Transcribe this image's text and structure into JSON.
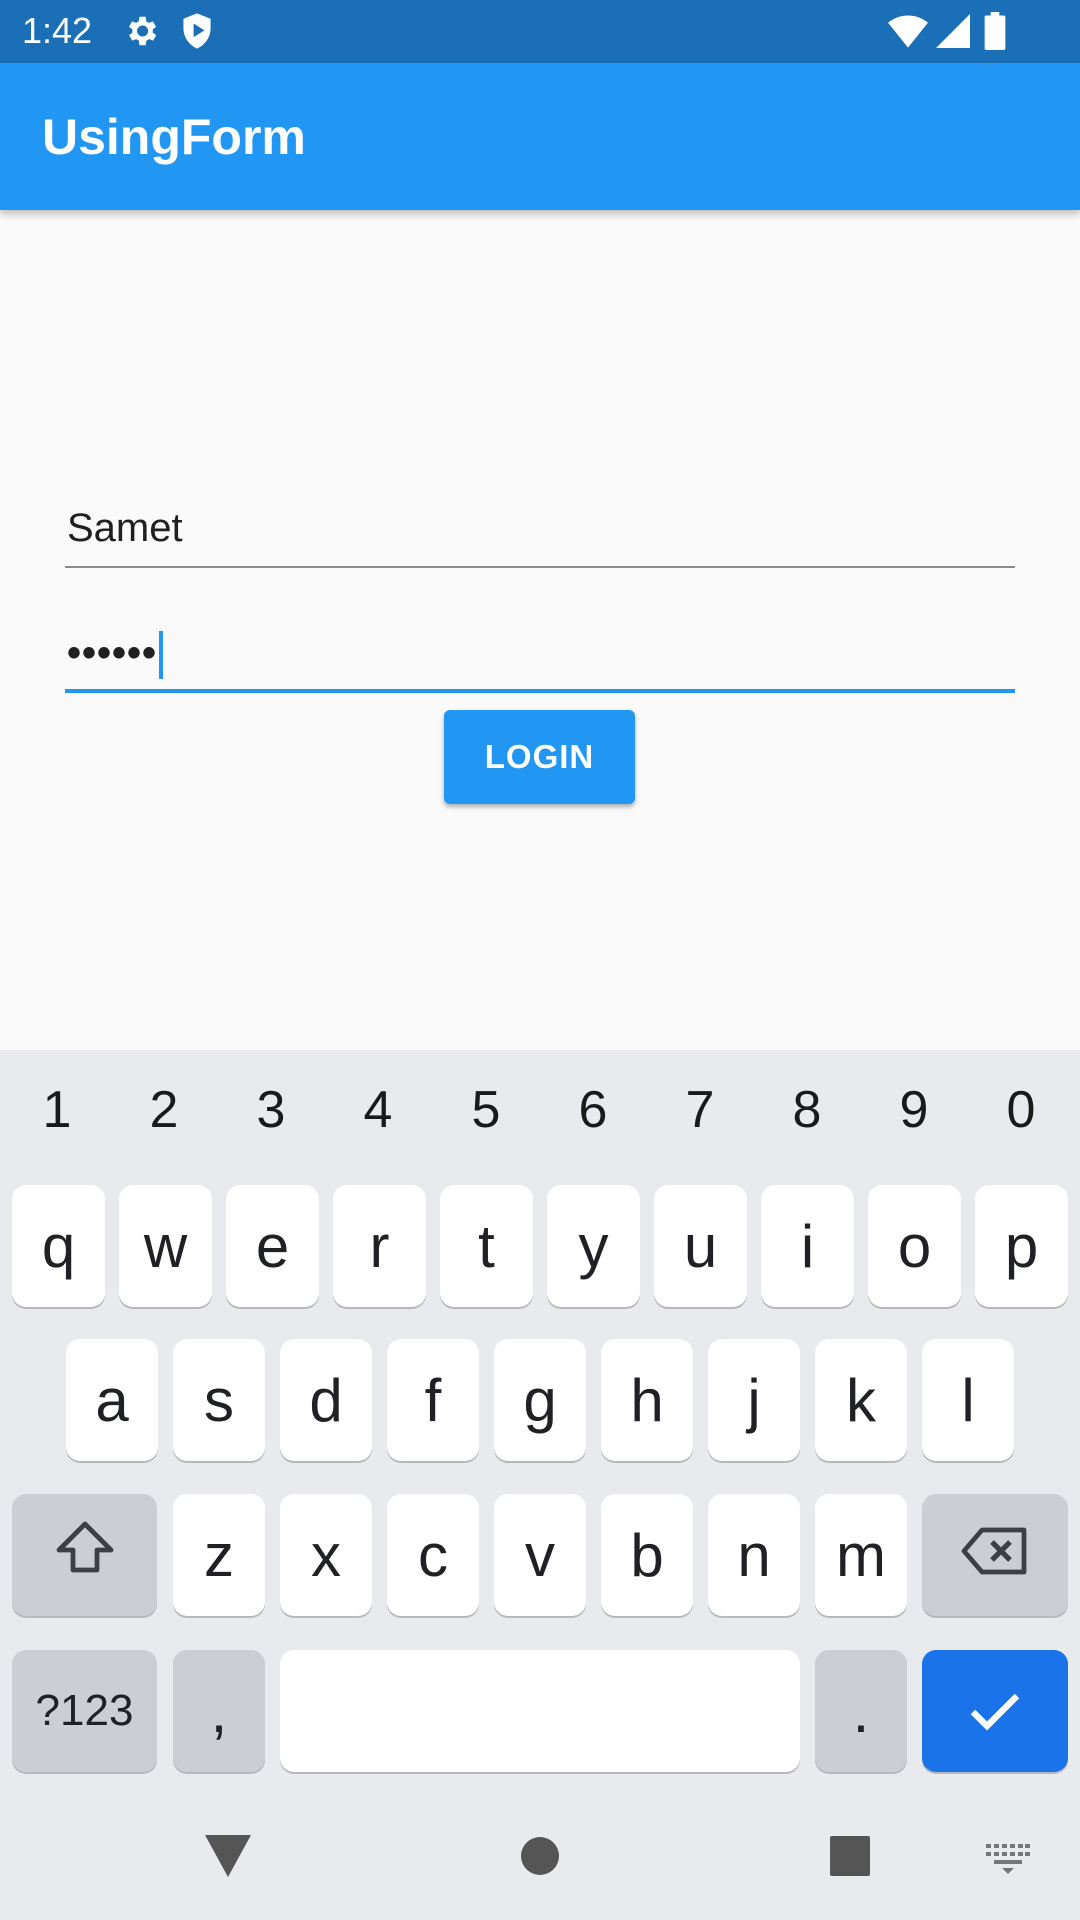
{
  "status_bar": {
    "time": "1:42",
    "icons": [
      "gear-icon",
      "shield-icon",
      "wifi-icon",
      "signal-icon",
      "battery-icon"
    ]
  },
  "app_bar": {
    "title": "UsingForm"
  },
  "form": {
    "username_value": "Samet",
    "password_value": "••••••",
    "login_label": "LOGIN"
  },
  "keyboard": {
    "number_row": [
      "1",
      "2",
      "3",
      "4",
      "5",
      "6",
      "7",
      "8",
      "9",
      "0"
    ],
    "row1": [
      "q",
      "w",
      "e",
      "r",
      "t",
      "y",
      "u",
      "i",
      "o",
      "p"
    ],
    "row2": [
      "a",
      "s",
      "d",
      "f",
      "g",
      "h",
      "j",
      "k",
      "l"
    ],
    "row3": [
      "z",
      "x",
      "c",
      "v",
      "b",
      "n",
      "m"
    ],
    "symbols_label": "?123",
    "comma_label": ",",
    "period_label": ".",
    "icons": [
      "shift-icon",
      "backspace-icon",
      "checkmark-icon"
    ]
  },
  "nav_bar": {
    "icons": [
      "back-icon",
      "home-icon",
      "recents-icon",
      "keyboard-switch-icon"
    ]
  },
  "colors": {
    "status_bar": "#1a6fb6",
    "app_bar": "#2196f3",
    "accent": "#2196f3",
    "keyboard_bg": "#e8eaed",
    "done_key": "#1a73e8"
  }
}
